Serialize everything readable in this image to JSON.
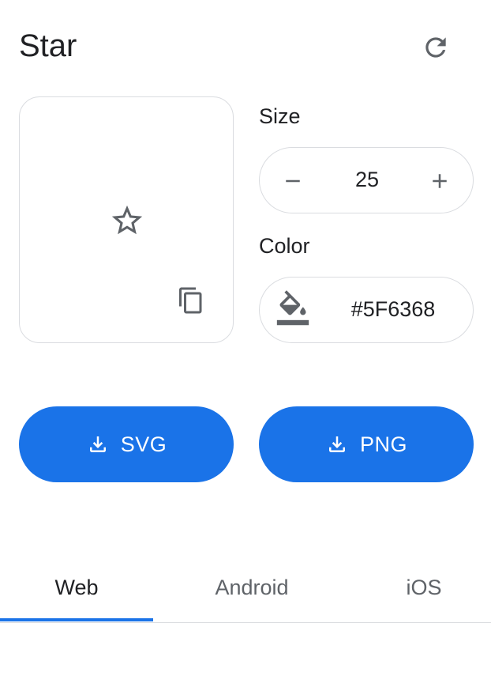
{
  "header": {
    "title": "Star",
    "reset_icon": "refresh-icon"
  },
  "preview": {
    "icon": "star-outline-icon",
    "copy_icon": "copy-icon"
  },
  "size": {
    "label": "Size",
    "value": "25",
    "minus_icon": "minus-icon",
    "plus_icon": "plus-icon"
  },
  "color": {
    "label": "Color",
    "value": "#5F6368",
    "bucket_icon": "paint-bucket-icon"
  },
  "downloads": [
    {
      "label": "SVG",
      "icon": "download-icon"
    },
    {
      "label": "PNG",
      "icon": "download-icon"
    }
  ],
  "tabs": [
    {
      "label": "Web",
      "active": true
    },
    {
      "label": "Android",
      "active": false
    },
    {
      "label": "iOS",
      "active": false
    }
  ],
  "colors": {
    "accent": "#1a73e8",
    "icon": "#5F6368",
    "border": "#dadce0",
    "text": "#202124"
  }
}
